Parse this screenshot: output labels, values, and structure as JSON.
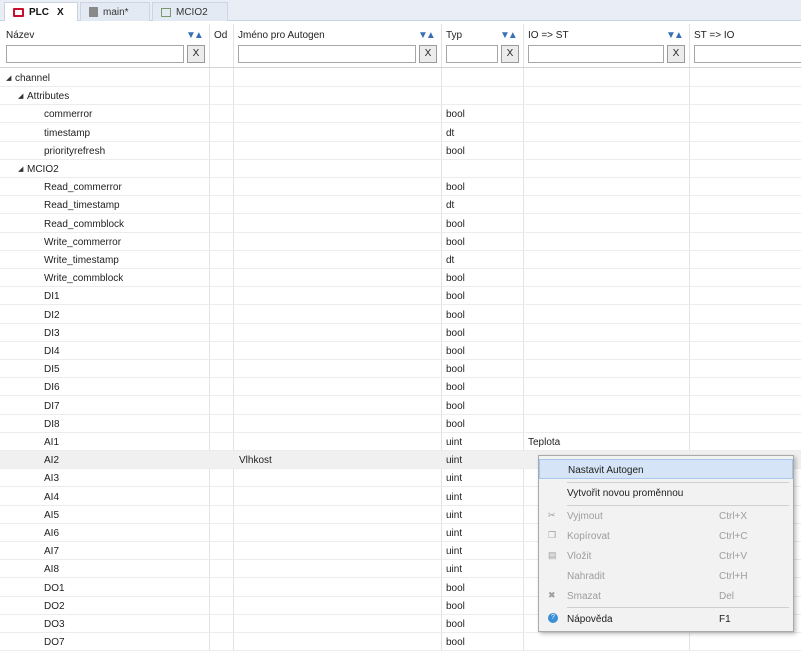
{
  "tabs": [
    {
      "label": "PLC",
      "close": "X"
    },
    {
      "label": "main*"
    },
    {
      "label": "MCIO2"
    }
  ],
  "columns": {
    "name": "Název",
    "from": "Od",
    "autogen": "Jméno pro Autogen",
    "type": "Typ",
    "io_st": "IO => ST",
    "st_io": "ST => IO"
  },
  "sort_glyph": "▼▲",
  "filter_clear": "X",
  "rows": [
    {
      "name": "channel",
      "autogen": "",
      "type": "",
      "io": "",
      "level": 0,
      "expand": "◢"
    },
    {
      "name": "Attributes",
      "autogen": "",
      "type": "",
      "io": "",
      "level": 1,
      "expand": "◢"
    },
    {
      "name": "commerror",
      "autogen": "",
      "type": "bool",
      "io": "",
      "level": 2
    },
    {
      "name": "timestamp",
      "autogen": "",
      "type": "dt",
      "io": "",
      "level": 2
    },
    {
      "name": "priorityrefresh",
      "autogen": "",
      "type": "bool",
      "io": "",
      "level": 2
    },
    {
      "name": "MCIO2",
      "autogen": "",
      "type": "",
      "io": "",
      "level": 1,
      "expand": "◢"
    },
    {
      "name": "Read_commerror",
      "autogen": "",
      "type": "bool",
      "io": "",
      "level": 2
    },
    {
      "name": "Read_timestamp",
      "autogen": "",
      "type": "dt",
      "io": "",
      "level": 2
    },
    {
      "name": "Read_commblock",
      "autogen": "",
      "type": "bool",
      "io": "",
      "level": 2
    },
    {
      "name": "Write_commerror",
      "autogen": "",
      "type": "bool",
      "io": "",
      "level": 2
    },
    {
      "name": "Write_timestamp",
      "autogen": "",
      "type": "dt",
      "io": "",
      "level": 2
    },
    {
      "name": "Write_commblock",
      "autogen": "",
      "type": "bool",
      "io": "",
      "level": 2
    },
    {
      "name": "DI1",
      "autogen": "",
      "type": "bool",
      "io": "",
      "level": 2
    },
    {
      "name": "DI2",
      "autogen": "",
      "type": "bool",
      "io": "",
      "level": 2
    },
    {
      "name": "DI3",
      "autogen": "",
      "type": "bool",
      "io": "",
      "level": 2
    },
    {
      "name": "DI4",
      "autogen": "",
      "type": "bool",
      "io": "",
      "level": 2
    },
    {
      "name": "DI5",
      "autogen": "",
      "type": "bool",
      "io": "",
      "level": 2
    },
    {
      "name": "DI6",
      "autogen": "",
      "type": "bool",
      "io": "",
      "level": 2
    },
    {
      "name": "DI7",
      "autogen": "",
      "type": "bool",
      "io": "",
      "level": 2
    },
    {
      "name": "DI8",
      "autogen": "",
      "type": "bool",
      "io": "",
      "level": 2
    },
    {
      "name": "AI1",
      "autogen": "",
      "type": "uint",
      "io": "Teplota",
      "level": 2
    },
    {
      "name": "AI2",
      "autogen": "Vlhkost",
      "type": "uint",
      "io": "",
      "level": 2,
      "selected": true
    },
    {
      "name": "AI3",
      "autogen": "",
      "type": "uint",
      "io": "",
      "level": 2
    },
    {
      "name": "AI4",
      "autogen": "",
      "type": "uint",
      "io": "",
      "level": 2
    },
    {
      "name": "AI5",
      "autogen": "",
      "type": "uint",
      "io": "",
      "level": 2
    },
    {
      "name": "AI6",
      "autogen": "",
      "type": "uint",
      "io": "",
      "level": 2
    },
    {
      "name": "AI7",
      "autogen": "",
      "type": "uint",
      "io": "",
      "level": 2
    },
    {
      "name": "AI8",
      "autogen": "",
      "type": "uint",
      "io": "",
      "level": 2
    },
    {
      "name": "DO1",
      "autogen": "",
      "type": "bool",
      "io": "",
      "level": 2
    },
    {
      "name": "DO2",
      "autogen": "",
      "type": "bool",
      "io": "",
      "level": 2
    },
    {
      "name": "DO3",
      "autogen": "",
      "type": "bool",
      "io": "",
      "level": 2
    },
    {
      "name": "DO7",
      "autogen": "",
      "type": "bool",
      "io": "",
      "level": 2
    }
  ],
  "context_menu": [
    {
      "label": "Nastavit Autogen",
      "shortcut": "",
      "icon": "",
      "state": "highlighted"
    },
    {
      "label": "Vytvořit novou proměnnou",
      "shortcut": "",
      "icon": "",
      "state": "enabled"
    },
    {
      "label": "Vyjmout",
      "shortcut": "Ctrl+X",
      "icon": "scissors-icon",
      "state": "disabled"
    },
    {
      "label": "Kopírovat",
      "shortcut": "Ctrl+C",
      "icon": "copy-icon",
      "state": "disabled"
    },
    {
      "label": "Vložit",
      "shortcut": "Ctrl+V",
      "icon": "paste-icon",
      "state": "disabled"
    },
    {
      "label": "Nahradit",
      "shortcut": "Ctrl+H",
      "icon": "",
      "state": "disabled"
    },
    {
      "label": "Smazat",
      "shortcut": "Del",
      "icon": "delete-icon",
      "state": "disabled"
    },
    {
      "label": "Nápověda",
      "shortcut": "F1",
      "icon": "help-icon",
      "state": "enabled"
    }
  ],
  "colors": {
    "accent": "#3a6fb5",
    "plc_icon": "#c8102e",
    "menu_highlight": "#d5e4f6"
  }
}
